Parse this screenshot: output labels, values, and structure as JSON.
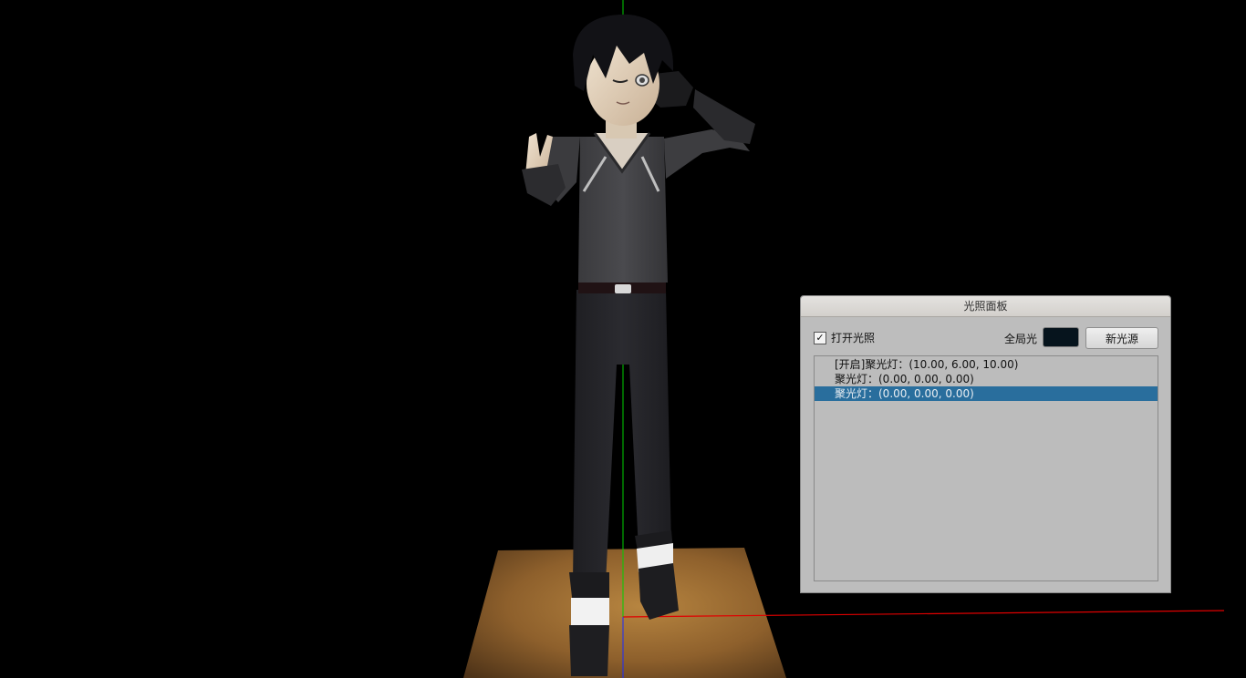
{
  "panel": {
    "title": "光照面板",
    "enable_lighting_label": "打开光照",
    "enable_lighting_checked": true,
    "check_glyph": "✓",
    "ambient_label": "全局光",
    "ambient_color": "#06141d",
    "new_light_button": "新光源",
    "lights": [
      {
        "label": "[开启]聚光灯：(10.00, 6.00, 10.00)",
        "selected": false
      },
      {
        "label": "聚光灯：(0.00, 0.00, 0.00)",
        "selected": false
      },
      {
        "label": "聚光灯：(0.00, 0.00, 0.00)",
        "selected": true
      }
    ]
  },
  "colors": {
    "background": "#000000",
    "y_axis": "#00c800",
    "x_axis": "#d40000",
    "floor_light": "#b07a38",
    "floor_dark": "#5a3c1c",
    "selection": "#296e9d"
  },
  "icons": {
    "checkbox": "check-icon"
  }
}
